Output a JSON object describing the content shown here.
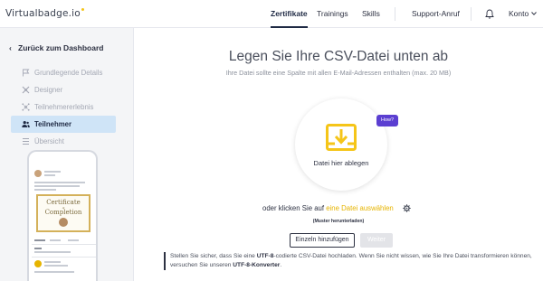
{
  "header": {
    "logo": "Virtualbadge.io",
    "nav": [
      "Zertifikate",
      "Trainings",
      "Skills"
    ],
    "support": "Support-Anruf",
    "account": "Konto"
  },
  "sidebar": {
    "back": "Zurück zum Dashboard",
    "items": [
      {
        "label": "Grundlegende Details",
        "icon": "flag-icon"
      },
      {
        "label": "Designer",
        "icon": "designer-icon"
      },
      {
        "label": "Teilnehmererlebnis",
        "icon": "network-icon"
      },
      {
        "label": "Teilnehmer",
        "icon": "users-icon"
      },
      {
        "label": "Übersicht",
        "icon": "list-icon"
      }
    ],
    "preview": {
      "cert_title_1": "Certificate",
      "cert_title_2": "Completion",
      "cert_small": "of"
    }
  },
  "main": {
    "title": "Legen Sie Ihre CSV-Datei unten ab",
    "subtitle": "Ihre Datei sollte eine Spalte mit allen E-Mail-Adressen enthalten (max. 20 MB)",
    "drop_label": "Datei hier ablegen",
    "how_label": "How?",
    "choose_prefix": "oder klicken Sie auf",
    "choose_link": "eine Datei auswählen",
    "sample_link": "(Muster herunterladen)",
    "add_single": "Einzeln hinzufügen",
    "next": "Weiter",
    "note_1": "Stellen Sie sicher, dass Sie eine",
    "note_b1": "UTF-8",
    "note_2": "-codierte CSV-Datei hochladen. Wenn Sie nicht wissen, wie Sie Ihre Datei transformieren können, versuchen Sie unseren",
    "note_b2": "UTF-8-Konverter",
    "note_3": "."
  },
  "colors": {
    "accent_yellow": "#f5c518",
    "active_nav": "#cfe4f7",
    "how_purple": "#5b3fd1"
  }
}
